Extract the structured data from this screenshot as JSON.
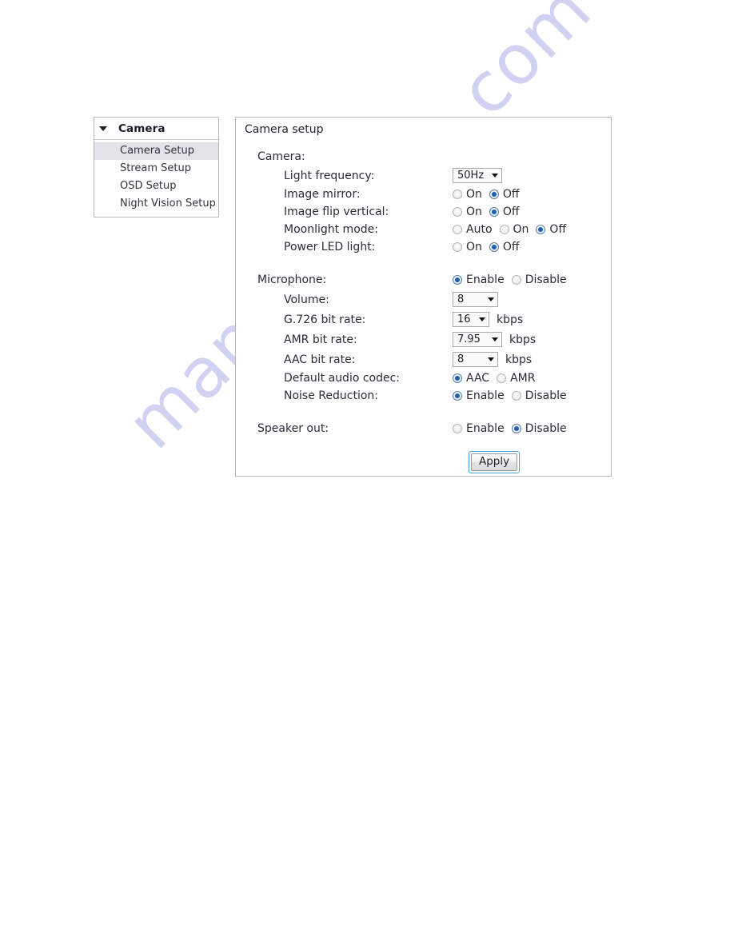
{
  "watermark": {
    "text": "manualshive.com"
  },
  "sidebar": {
    "header": "Camera",
    "items": [
      {
        "label": "Camera Setup",
        "selected": true
      },
      {
        "label": "Stream Setup",
        "selected": false
      },
      {
        "label": "OSD Setup",
        "selected": false
      },
      {
        "label": "Night Vision Setup",
        "selected": false
      }
    ]
  },
  "panel": {
    "title": "Camera setup",
    "sections": {
      "camera": {
        "label": "Camera:",
        "light_frequency": {
          "label": "Light frequency:",
          "value": "50Hz"
        },
        "image_mirror": {
          "label": "Image mirror:",
          "options": [
            "On",
            "Off"
          ],
          "selected": "Off"
        },
        "image_flip_vertical": {
          "label": "Image flip vertical:",
          "options": [
            "On",
            "Off"
          ],
          "selected": "Off"
        },
        "moonlight_mode": {
          "label": "Moonlight mode:",
          "options": [
            "Auto",
            "On",
            "Off"
          ],
          "selected": "Off"
        },
        "power_led_light": {
          "label": "Power LED light:",
          "options": [
            "On",
            "Off"
          ],
          "selected": "Off"
        }
      },
      "microphone": {
        "label": "Microphone:",
        "options": [
          "Enable",
          "Disable"
        ],
        "selected": "Enable",
        "volume": {
          "label": "Volume:",
          "value": "8"
        },
        "g726_bit_rate": {
          "label": "G.726 bit rate:",
          "value": "16",
          "unit": "kbps"
        },
        "amr_bit_rate": {
          "label": "AMR bit rate:",
          "value": "7.95",
          "unit": "kbps"
        },
        "aac_bit_rate": {
          "label": "AAC bit rate:",
          "value": "8",
          "unit": "kbps"
        },
        "default_audio_codec": {
          "label": "Default audio codec:",
          "options": [
            "AAC",
            "AMR"
          ],
          "selected": "AAC"
        },
        "noise_reduction": {
          "label": "Noise Reduction:",
          "options": [
            "Enable",
            "Disable"
          ],
          "selected": "Enable"
        }
      },
      "speaker_out": {
        "label": "Speaker out:",
        "options": [
          "Enable",
          "Disable"
        ],
        "selected": "Disable"
      }
    },
    "apply_button": "Apply"
  }
}
